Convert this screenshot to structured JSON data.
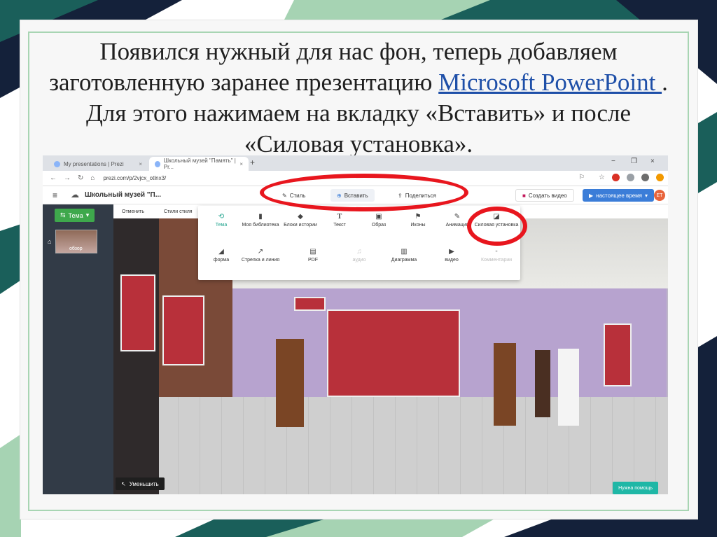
{
  "slide": {
    "text_before_link": "Появился нужный для нас фон, теперь добавляем заготовленную заранее презентацию ",
    "link_text": "Microsoft PowerPoint ",
    "text_after_link": ". Для этого нажимаем на вкладку «Вставить» и после «Силовая установка»."
  },
  "browser": {
    "tabs": [
      {
        "label": "My presentations | Prezi",
        "close": "×"
      },
      {
        "label": "Школьный музей \"Память\" | Pr...",
        "close": "×"
      }
    ],
    "new_tab": "+",
    "window_controls": [
      "−",
      "❐",
      "×"
    ],
    "url": "prezi.com/p/2vjcx_otlnx3/"
  },
  "prezi": {
    "title": "Школьный музей \"П...",
    "toolbar": {
      "style": "Стиль",
      "insert": "Вставить",
      "share": "Поделиться",
      "create_video": "Создать видео",
      "present": "настоящее время",
      "avatar": "ЕТ"
    },
    "left_panel": {
      "theme_button": "Тема",
      "thumbnail_label": "обзор"
    },
    "subbar": {
      "undo": "Отменить",
      "styles": "Стили стиля"
    },
    "insert_menu": {
      "row1": [
        {
          "label": "Тема",
          "icon": "theme-icon",
          "state": "active"
        },
        {
          "label": "Моя библиотека",
          "icon": "library-icon",
          "state": "normal"
        },
        {
          "label": "Блоки истории",
          "icon": "layers-icon",
          "state": "normal"
        },
        {
          "label": "Текст",
          "icon": "text-icon",
          "state": "normal"
        },
        {
          "label": "Образ",
          "icon": "image-icon",
          "state": "normal"
        },
        {
          "label": "Иконы",
          "icon": "flag-icon",
          "state": "normal"
        },
        {
          "label": "Анимация",
          "icon": "pen-icon",
          "state": "normal"
        },
        {
          "label": "Силовая установка",
          "icon": "powerpoint-icon",
          "state": "normal"
        }
      ],
      "row2": [
        {
          "label": "форма",
          "icon": "shape-icon",
          "state": "normal"
        },
        {
          "label": "Стрелка и линия",
          "icon": "arrow-icon",
          "state": "normal"
        },
        {
          "label": "PDF",
          "icon": "pdf-icon",
          "state": "normal"
        },
        {
          "label": "аудио",
          "icon": "music-icon",
          "state": "disabled"
        },
        {
          "label": "Диаграмма",
          "icon": "chart-icon",
          "state": "normal"
        },
        {
          "label": "видео",
          "icon": "video-icon",
          "state": "normal"
        },
        {
          "label": "Комментарии",
          "icon": "comment-icon",
          "state": "disabled"
        }
      ]
    },
    "shrink_button": "Уменьшить",
    "help_button": "Нужна помощь"
  },
  "colors": {
    "annotation": "#e8161e",
    "accent_green": "#3ea84c",
    "accent_teal": "#1fa38d",
    "present_blue": "#3b7dd8",
    "slide_dark_teal": "#1a5f5a",
    "slide_navy": "#14213a"
  }
}
